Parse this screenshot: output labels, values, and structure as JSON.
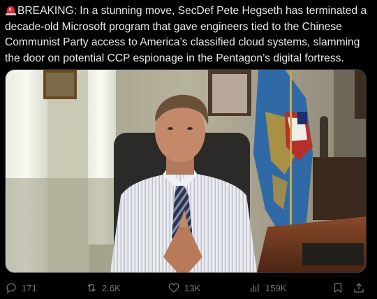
{
  "post": {
    "text": "BREAKING: In a stunning move, SecDef Pete Hegseth has terminated a decade-old Microsoft program that gave engineers tied to the Chinese Communist Party access to America’s classified cloud systems, slamming the door on potential CCP espionage in the Pentagon’s digital fortress.",
    "leading_icon": "police-car-light-icon"
  },
  "media": {
    "type": "video-thumbnail",
    "subject": "man in striped shirt at desk with flags"
  },
  "actions": {
    "replies": "171",
    "reposts": "2.6K",
    "likes": "13K",
    "views": "159K"
  },
  "colors": {
    "background": "#000000",
    "text": "#e7e9ea",
    "muted": "#71767b",
    "accent": "#1d9bf0"
  }
}
